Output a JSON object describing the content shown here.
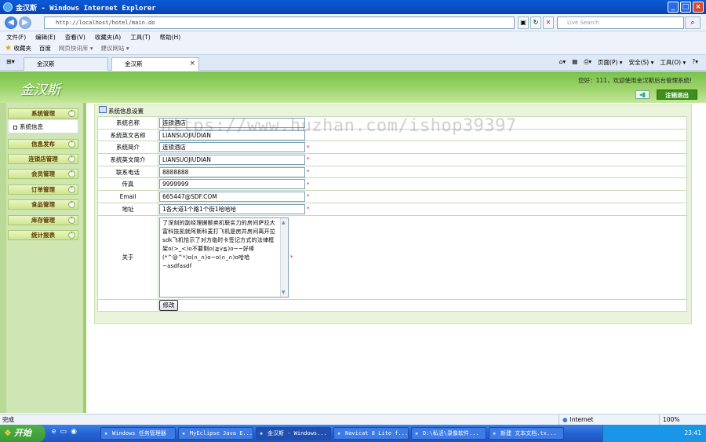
{
  "browser": {
    "title": "金汉斯 - Windows Internet Explorer",
    "address": "http://localhost/hotel/main.do",
    "search_placeholder": "Live Search",
    "menus": [
      "文件(F)",
      "编辑(E)",
      "查看(V)",
      "收藏夹(A)",
      "工具(T)",
      "帮助(H)"
    ],
    "favorites": {
      "label": "收藏夹",
      "items": [
        "百度",
        "网页快讯库 ▾",
        "建议网站 ▾"
      ]
    },
    "tabs": [
      "金汉斯",
      "金汉斯"
    ],
    "tab_tools": [
      "页面(P) ▾",
      "安全(S) ▾",
      "工具(O) ▾"
    ],
    "status": {
      "left": "完成",
      "zone": "Internet",
      "zoom": "100%"
    }
  },
  "app": {
    "logo": "金汉斯",
    "welcome": "您好：111，欢迎使用金汉斯后台管理系统!",
    "logout": "注销退出"
  },
  "sidebar": {
    "items": [
      "系统管理",
      "信息发布",
      "连锁店管理",
      "会员管理",
      "订单管理",
      "食品管理",
      "库存管理",
      "统计报表"
    ],
    "sub_item": "系统信息"
  },
  "panel": {
    "title": "系统信息设置",
    "fields": [
      {
        "label": "系统名称",
        "value": "连锁酒店",
        "required": false
      },
      {
        "label": "系统英文名称",
        "value": "LIANSUOJIUDIAN",
        "required": false
      },
      {
        "label": "系统简介",
        "value": "连锁酒店",
        "required": true
      },
      {
        "label": "系统英文简介",
        "value": "LIANSUOJIUDIAN",
        "required": true
      },
      {
        "label": "联系电话",
        "value": "8888888",
        "required": true
      },
      {
        "label": "传真",
        "value": "9999999",
        "required": true
      },
      {
        "label": "Email",
        "value": "665447@SDF.COM",
        "required": true
      },
      {
        "label": "地址",
        "value": "1各大道1个路1个街1哈哈哈",
        "required": true
      }
    ],
    "about_label": "关于",
    "about_text": "了深刻的副经理据额卖机联实力的房间萨拉大富科技凯就阿斯科麦打飞机是房并房间离开拉sdk飞机恰示了对方临时卡签记方式的法律框架o(>_<)o不要剩o(≧v≦)o~~好棒(*^@^*)o(∩_∩)o~o(∩_∩)o哈哈~asdfasdf",
    "edit_button": "修改"
  },
  "watermark": "https://www.huzhan.com/ishop39397",
  "taskbar": {
    "start": "开始",
    "tasks": [
      "Windows 任务管理器",
      "MyEclipse Java E...",
      "金汉斯 - Windows...",
      "Navicat 8 Lite f...",
      "D:\\私活\\录像软件...",
      "新建 文本文档.tx..."
    ],
    "clock": "23:41"
  }
}
